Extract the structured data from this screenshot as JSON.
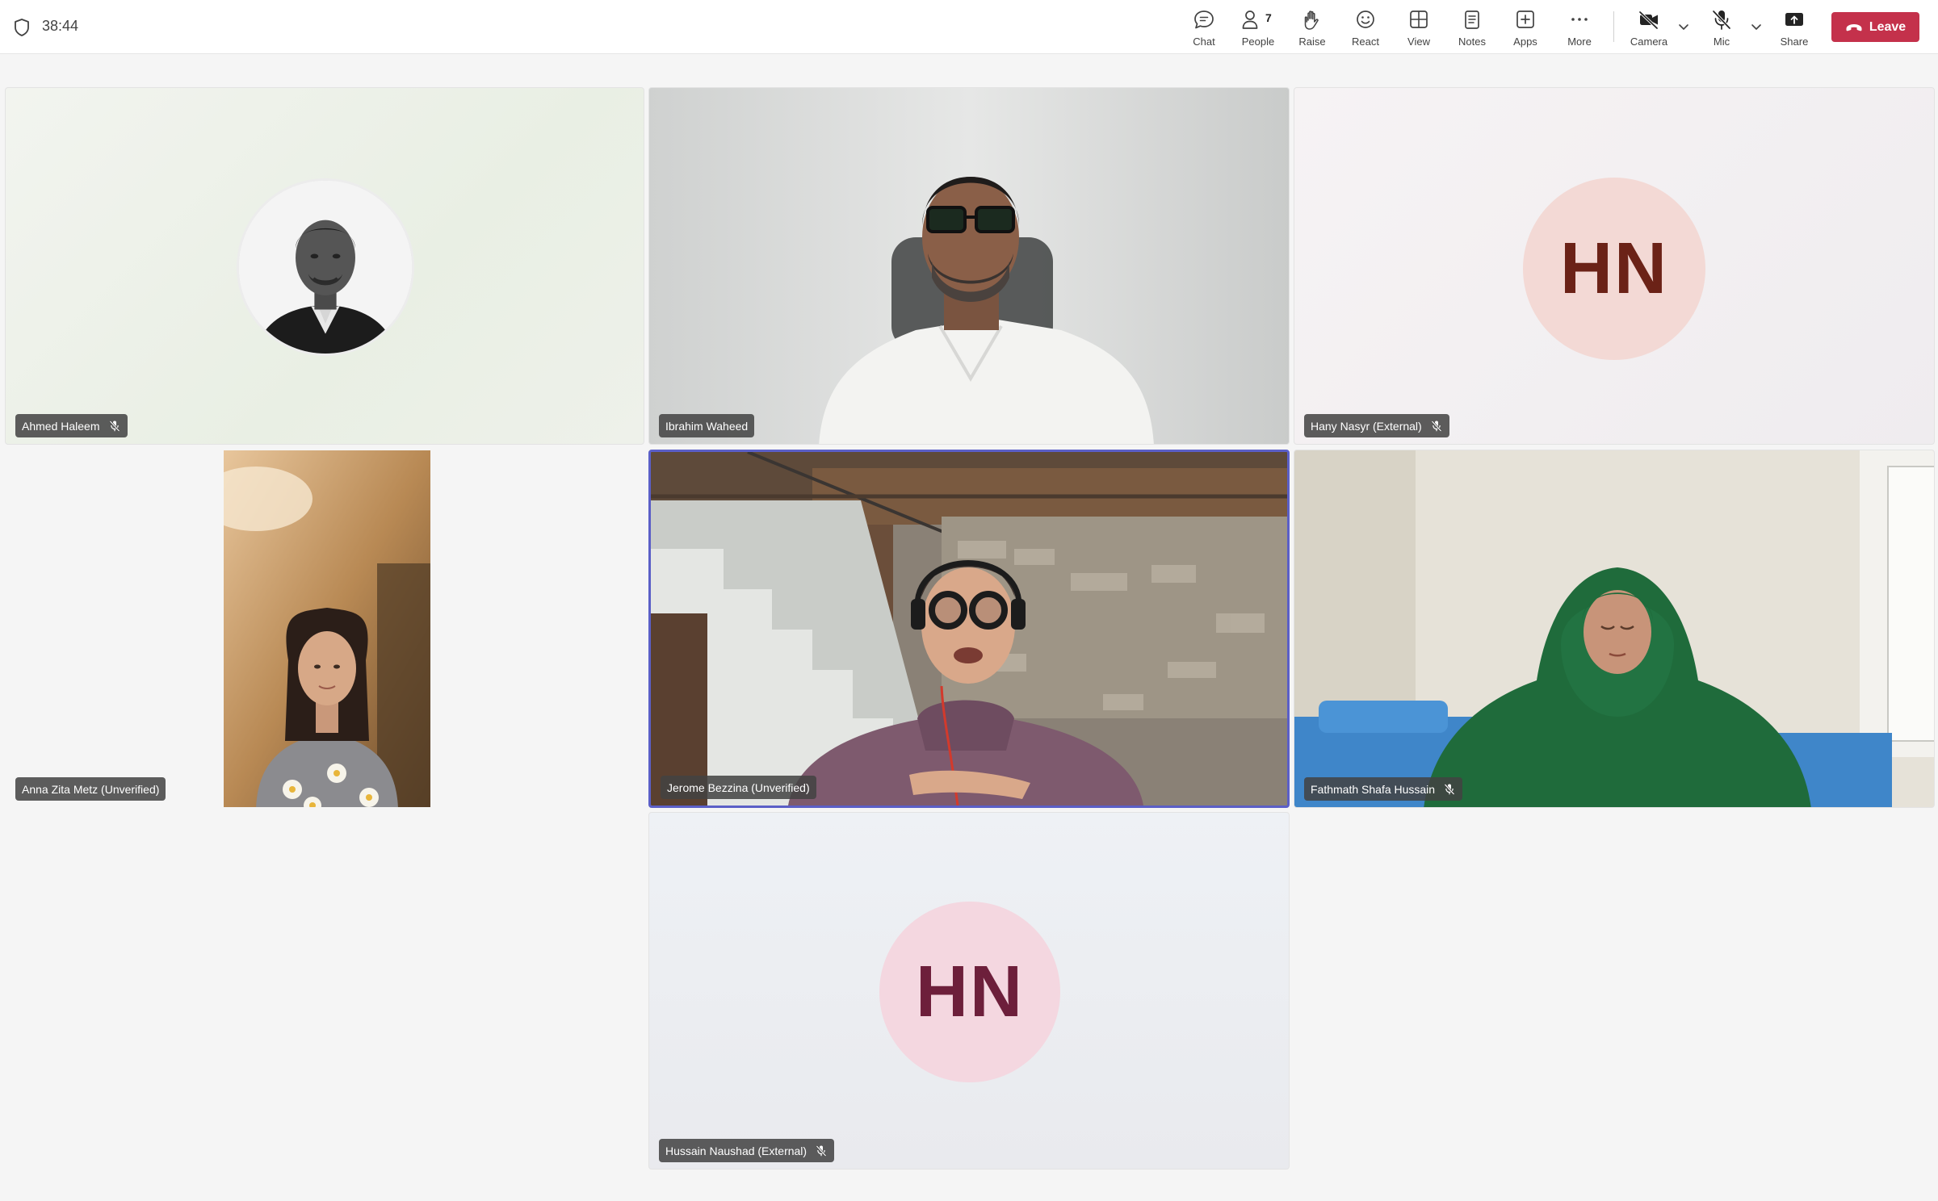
{
  "meeting": {
    "timer": "38:44"
  },
  "toolbar": {
    "chat": "Chat",
    "people": "People",
    "people_count": "7",
    "raise": "Raise",
    "react": "React",
    "view": "View",
    "notes": "Notes",
    "apps": "Apps",
    "more": "More",
    "camera": "Camera",
    "mic": "Mic",
    "share": "Share",
    "leave": "Leave"
  },
  "participants": [
    {
      "name": "Ahmed Haleem",
      "muted": true
    },
    {
      "name": "Ibrahim Waheed",
      "muted": false
    },
    {
      "name": "Hany Nasyr (External)",
      "initials": "HN",
      "muted": true
    },
    {
      "name": "Anna Zita Metz (Unverified)",
      "muted": false
    },
    {
      "name": "Jerome Bezzina (Unverified)",
      "muted": false,
      "speaking": true
    },
    {
      "name": "Fathmath Shafa Hussain",
      "muted": true
    },
    {
      "name": "Hussain Naushad (External)",
      "initials": "HN",
      "muted": true
    }
  ],
  "colors": {
    "leave": "#c4314b",
    "active_speaker": "#5b5fc7",
    "hn_avatar_1_bg": "#f3d9d5",
    "hn_avatar_1_text": "#6b2217",
    "hn_avatar_2_bg": "#f4d7e0",
    "hn_avatar_2_text": "#6d1f3b"
  }
}
